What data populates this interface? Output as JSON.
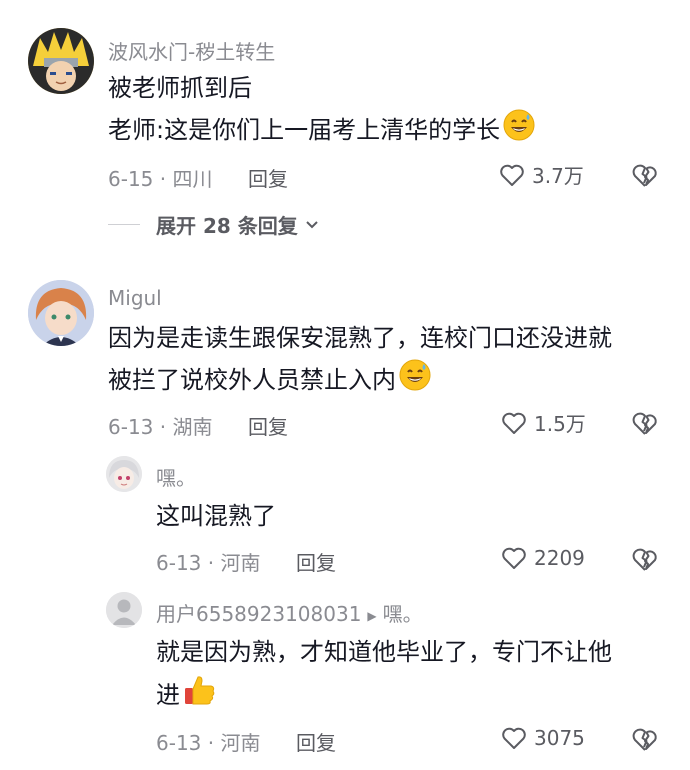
{
  "comments": [
    {
      "username": "波风水门-秽土转生",
      "lines": [
        "被老师抓到后",
        "老师:这是你们上一届考上清华的学长"
      ],
      "date_location": "6-15 · 四川",
      "reply_label": "回复",
      "likes": "3.7万",
      "expand_label": "展开 28 条回复"
    },
    {
      "username": "Migul",
      "lines": [
        "因为是走读生跟保安混熟了，连校门口还没进就",
        "被拦了说校外人员禁止入内"
      ],
      "date_location": "6-13 · 湖南",
      "reply_label": "回复",
      "likes": "1.5万"
    }
  ],
  "replies": [
    {
      "username": "嘿。",
      "lines": [
        "这叫混熟了"
      ],
      "date_location": "6-13 · 河南",
      "reply_label": "回复",
      "likes": "2209"
    },
    {
      "username": "用户6558923108031",
      "reply_to": "嘿。",
      "lines": [
        "就是因为熟，才知道他毕业了，专门不让他",
        "进"
      ],
      "date_location": "6-13 · 河南",
      "reply_label": "回复",
      "likes": "3075"
    }
  ],
  "icons": {
    "like": "heart-outline-icon",
    "dislike": "broken-heart-icon",
    "expand": "chevron-down-icon",
    "emoji_laugh": "grinning-sweat-emoji",
    "emoji_thumb": "thumbs-up-emoji"
  }
}
